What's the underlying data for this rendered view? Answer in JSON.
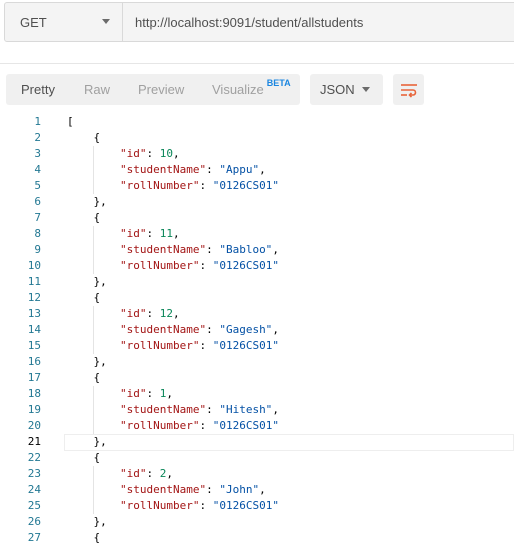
{
  "request": {
    "method": "GET",
    "url": "http://localhost:9091/student/allstudents"
  },
  "toolbar": {
    "tabs": [
      "Pretty",
      "Raw",
      "Preview",
      "Visualize"
    ],
    "beta_badge": "BETA",
    "active_tab": "Pretty",
    "format": "JSON",
    "wrap_icon": "wrap-lines-icon",
    "accent_color": "#e8643a"
  },
  "editor": {
    "current_line": 21,
    "lines": [
      "[",
      "    {",
      "        \"id\": 10,",
      "        \"studentName\": \"Appu\",",
      "        \"rollNumber\": \"0126CS01\"",
      "    },",
      "    {",
      "        \"id\": 11,",
      "        \"studentName\": \"Babloo\",",
      "        \"rollNumber\": \"0126CS01\"",
      "    },",
      "    {",
      "        \"id\": 12,",
      "        \"studentName\": \"Gagesh\",",
      "        \"rollNumber\": \"0126CS01\"",
      "    },",
      "    {",
      "        \"id\": 1,",
      "        \"studentName\": \"Hitesh\",",
      "        \"rollNumber\": \"0126CS01\"",
      "    },",
      "    {",
      "        \"id\": 2,",
      "        \"studentName\": \"John\",",
      "        \"rollNumber\": \"0126CS01\"",
      "    },",
      "    {"
    ]
  }
}
